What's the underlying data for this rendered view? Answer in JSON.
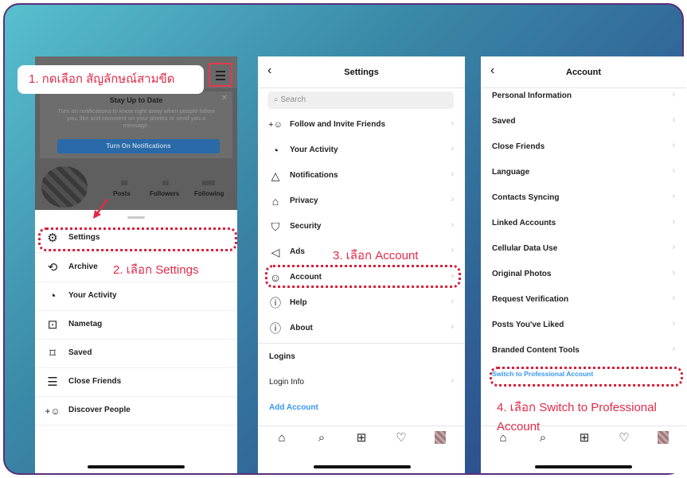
{
  "annotations": {
    "step1": "1. กดเลือก สัญลักษณ์สามขีด",
    "step2": "2. เลือก Settings",
    "step3": "3. เลือก Account",
    "step4a": "4. เลือก Switch to Professional",
    "step4b": "Account"
  },
  "phone1": {
    "banner_title": "Stay Up to Date",
    "banner_desc": "Turn on notifications to know right away when people follow you, like and comment on your photos or send you a message.",
    "banner_button": "Turn On Notifications",
    "stats": [
      "Posts",
      "Followers",
      "Following"
    ],
    "menu": [
      {
        "label": "Settings",
        "icon": "settings-icon",
        "glyph": "⚙"
      },
      {
        "label": "Archive",
        "icon": "archive-icon",
        "glyph": "⟲"
      },
      {
        "label": "Your Activity",
        "icon": "activity-icon",
        "glyph": "◔"
      },
      {
        "label": "Nametag",
        "icon": "nametag-icon",
        "glyph": "⊡"
      },
      {
        "label": "Saved",
        "icon": "saved-icon",
        "glyph": "⌑"
      },
      {
        "label": "Close Friends",
        "icon": "close-friends-icon",
        "glyph": "☰"
      },
      {
        "label": "Discover People",
        "icon": "discover-people-icon",
        "glyph": "+☺"
      }
    ]
  },
  "phone2": {
    "title": "Settings",
    "search_placeholder": "Search",
    "items": [
      {
        "label": "Follow and Invite Friends",
        "glyph": "+☺",
        "icon": "follow-icon"
      },
      {
        "label": "Your Activity",
        "glyph": "◔",
        "icon": "activity-icon"
      },
      {
        "label": "Notifications",
        "glyph": "♫",
        "icon": "bell-icon"
      },
      {
        "label": "Privacy",
        "glyph": "🔒",
        "icon": "lock-icon"
      },
      {
        "label": "Security",
        "glyph": "⛉",
        "icon": "shield-icon"
      },
      {
        "label": "Ads",
        "glyph": "📢",
        "icon": "megaphone-icon"
      },
      {
        "label": "Account",
        "glyph": "☺",
        "icon": "account-icon"
      },
      {
        "label": "Help",
        "glyph": "?",
        "icon": "help-icon"
      },
      {
        "label": "About",
        "glyph": "i",
        "icon": "info-icon"
      }
    ],
    "logins_header": "Logins",
    "login_info": "Login Info",
    "add_account": "Add Account"
  },
  "phone3": {
    "title": "Account",
    "items": [
      "Personal Information",
      "Saved",
      "Close Friends",
      "Language",
      "Contacts Syncing",
      "Linked Accounts",
      "Cellular Data Use",
      "Original Photos",
      "Request Verification",
      "Posts You've Liked",
      "Branded Content Tools"
    ],
    "switch_label": "Switch to Professional Account"
  },
  "tabbar_icons": [
    "home-icon",
    "search-icon",
    "add-icon",
    "heart-icon",
    "profile-avatar"
  ]
}
